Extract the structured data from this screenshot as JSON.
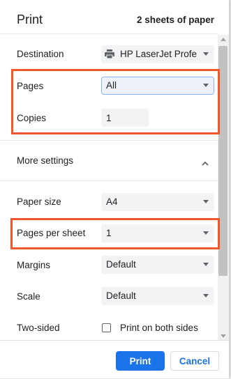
{
  "header": {
    "title": "Print",
    "sheets_summary": "2 sheets of paper"
  },
  "destination": {
    "label": "Destination",
    "value": "HP LaserJet Profe",
    "icon": "printer-icon"
  },
  "pages": {
    "label": "Pages",
    "value": "All"
  },
  "copies": {
    "label": "Copies",
    "value": "1"
  },
  "more_settings": {
    "label": "More settings",
    "icon": "chevron-up-icon",
    "expanded": true
  },
  "paper_size": {
    "label": "Paper size",
    "value": "A4"
  },
  "pages_per_sheet": {
    "label": "Pages per sheet",
    "value": "1"
  },
  "margins": {
    "label": "Margins",
    "value": "Default"
  },
  "scale": {
    "label": "Scale",
    "value": "Default"
  },
  "two_sided": {
    "label": "Two-sided",
    "checkbox_label": "Print on both sides",
    "checked": false
  },
  "buttons": {
    "print": "Print",
    "cancel": "Cancel"
  },
  "colors": {
    "accent": "#1a73e8",
    "highlight": "#f0572a",
    "select_bg": "#f1f3f4",
    "text": "#202124"
  }
}
